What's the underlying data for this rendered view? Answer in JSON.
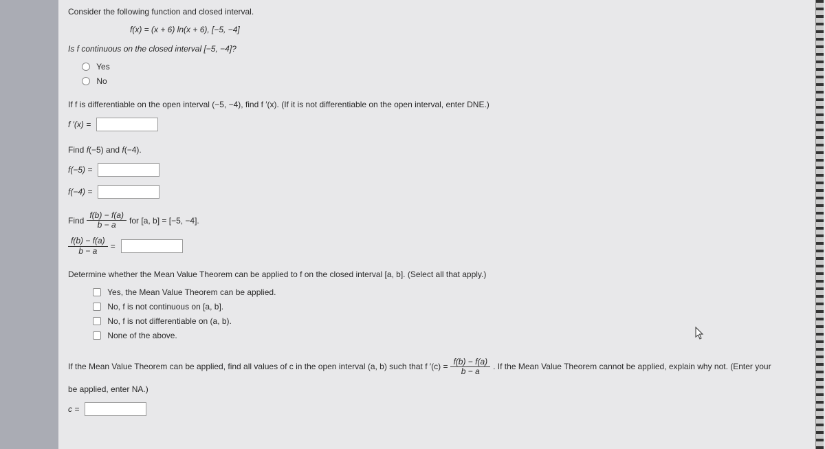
{
  "intro": "Consider the following function and closed interval.",
  "func_def": "f(x) = (x + 6) ln(x + 6), [−5, −4]",
  "q1": {
    "prompt": "Is f continuous on the closed interval [−5, −4]?",
    "opt_yes": "Yes",
    "opt_no": "No"
  },
  "q2": {
    "prompt": "If f is differentiable on the open interval (−5, −4), find f ′(x). (If it is not differentiable on the open interval, enter DNE.)",
    "label": "f ′(x) ="
  },
  "q3": {
    "prompt": "Find f(−5) and f(−4).",
    "f5_label": "f(−5)  =",
    "f4_label": "f(−4)  ="
  },
  "q4": {
    "prompt_pre": "Find ",
    "frac_num": "f(b) − f(a)",
    "frac_den": "b − a",
    "prompt_post": " for [a, b] = [−5, −4].",
    "ans_num": "f(b) − f(a)",
    "ans_den": "b − a",
    "equals": " ="
  },
  "q5": {
    "prompt": "Determine whether the Mean Value Theorem can be applied to f on the closed interval [a, b]. (Select all that apply.)",
    "opt1": "Yes, the Mean Value Theorem can be applied.",
    "opt2": "No, f is not continuous on [a, b].",
    "opt3": "No, f is not differentiable on (a, b).",
    "opt4": "None of the above."
  },
  "q6": {
    "pre": "If the Mean Value Theorem can be applied, find all values of c in the open interval (a, b) such that f ′(c) = ",
    "frac_num": "f(b) − f(a)",
    "frac_den": "b − a",
    "post": ". If the Mean Value Theorem cannot be applied, explain why not. (Enter your",
    "line2": "be applied, enter NA.)",
    "label": "c ="
  }
}
